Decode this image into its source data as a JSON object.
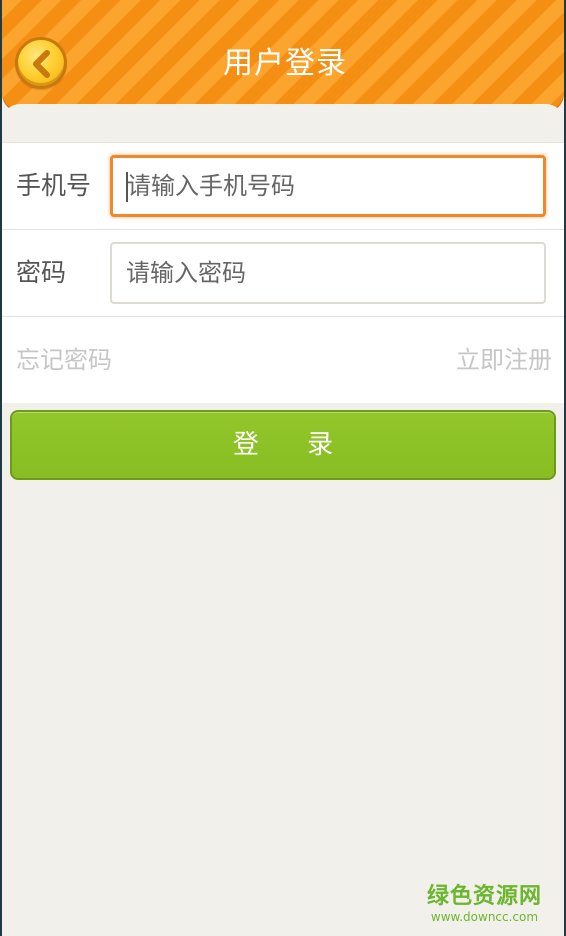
{
  "header": {
    "title": "用户登录",
    "back_icon": "chevron-left-icon",
    "colors": {
      "stripe_light": "#fba52f",
      "stripe_dark": "#f48f14",
      "back_button": "#ffd032"
    }
  },
  "form": {
    "phone": {
      "label": "手机号",
      "value": "",
      "placeholder": "请输入手机号码"
    },
    "password": {
      "label": "密码",
      "value": "",
      "placeholder": "请输入密码"
    },
    "forgot_password": "忘记密码",
    "register_now": "立即注册"
  },
  "login_button": {
    "label": "登 录",
    "color": "#8cc223"
  },
  "watermark": {
    "title": "绿色资源网",
    "url": "www.downcc.com"
  }
}
